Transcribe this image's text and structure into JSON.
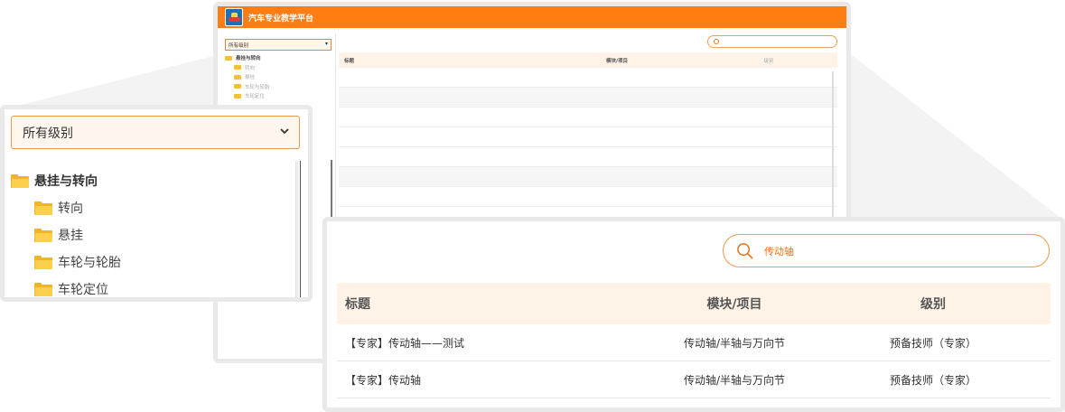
{
  "app": {
    "title": "汽车专业教学平台",
    "accent_color": "#ff7d12"
  },
  "level_select": {
    "value": "所有级别",
    "icon": "chevron-down-icon"
  },
  "tree": {
    "items": [
      {
        "label": "悬挂与转向",
        "level": 0,
        "icon": "folder-icon"
      },
      {
        "label": "转向",
        "level": 1,
        "icon": "folder-icon"
      },
      {
        "label": "悬挂",
        "level": 1,
        "icon": "folder-icon"
      },
      {
        "label": "车轮与轮胎",
        "level": 1,
        "icon": "folder-icon"
      },
      {
        "label": "车轮定位",
        "level": 1,
        "icon": "folder-icon"
      }
    ]
  },
  "search": {
    "value": "传动轴",
    "icon": "search-icon"
  },
  "table": {
    "columns": [
      "标题",
      "模块/项目",
      "级别"
    ],
    "rows": [
      {
        "title": "【专家】传动轴——测试",
        "module": "传动轴/半轴与万向节",
        "level": "预备技师（专家）"
      },
      {
        "title": "【专家】传动轴",
        "module": "传动轴/半轴与万向节",
        "level": "预备技师（专家）"
      }
    ]
  }
}
